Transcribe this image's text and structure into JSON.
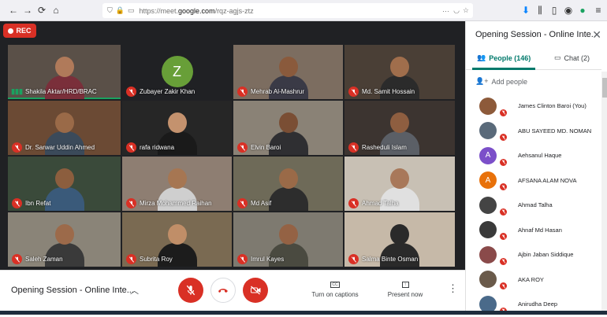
{
  "browser": {
    "url_prefix": "https://meet.",
    "url_host": "google.com",
    "url_path": "/rqz-agjs-ztz"
  },
  "rec_label": "REC",
  "tiles": [
    {
      "name": "Shakila Aktar/HRD/BRAC",
      "speaking": true,
      "bg": "#5a5048",
      "skin": "#b07a5a",
      "shirt": "#7a2f3a"
    },
    {
      "name": "Zubayer Zakir Khan",
      "avatar": "Z",
      "bg": "#202124"
    },
    {
      "name": "Mehrab Al-Mashrur",
      "bg": "#7c6d60",
      "skin": "#8a5a3c",
      "shirt": "#3a3a46"
    },
    {
      "name": "Md. Samit Hossain",
      "bg": "#4a3f36",
      "skin": "#a06e4c",
      "shirt": "#2b2b2b"
    },
    {
      "name": "Dr. Sarwar Uddin Ahmed",
      "bg": "#6b4a34",
      "skin": "#9a6a48",
      "shirt": "#3b4a5a"
    },
    {
      "name": "rafa ridwana",
      "bg": "#262626",
      "skin": "#c4926e",
      "shirt": "#1a1a1a"
    },
    {
      "name": "Elvin Baroi",
      "bg": "#8a8276",
      "skin": "#7a4e34",
      "shirt": "#2f2f32"
    },
    {
      "name": "Rasheduli Islam",
      "bg": "#3c3430",
      "skin": "#8e5e40",
      "shirt": "#5b5f66"
    },
    {
      "name": "Ibn Refat",
      "bg": "#3a4a3a",
      "skin": "#8c5e3e",
      "shirt": "#3a5a7a"
    },
    {
      "name": "Mirza Mohammed Raihan",
      "bg": "#8e7e72",
      "skin": "#a67652",
      "shirt": "#cfcfcf"
    },
    {
      "name": "Md Asif",
      "bg": "#6e6a58",
      "skin": "#9a6a48",
      "shirt": "#2d2d2d"
    },
    {
      "name": "Ahmad Talha",
      "bg": "#c8c0b4",
      "skin": "#a8785a",
      "shirt": "#e0e0e0"
    },
    {
      "name": "Saleh Zaman",
      "bg": "#8a8478",
      "skin": "#9c6a4a",
      "shirt": "#3a3a3a"
    },
    {
      "name": "Subrita Roy",
      "bg": "#7a6a52",
      "skin": "#c08e68",
      "shirt": "#1c1c1c"
    },
    {
      "name": "Imrul Kayes",
      "bg": "#7e7a70",
      "skin": "#946244",
      "shirt": "#4a4a40"
    },
    {
      "name": "Salma Binte Osman",
      "bg": "#c6b9a8",
      "skin": "#2a2a2a",
      "shirt": "#2a2a2a"
    }
  ],
  "bottom": {
    "meeting_title": "Opening Session - Online Inte...",
    "captions_label": "Turn on captions",
    "present_label": "Present now"
  },
  "side": {
    "title": "Opening Session - Online Inte...",
    "people_tab": "People (146)",
    "chat_tab": "Chat (2)",
    "add_people": "Add people",
    "participants": [
      {
        "name": "James Clinton Baroi (You)",
        "color": "#8d5a3a",
        "initial": ""
      },
      {
        "name": "ABU SAYEED MD. NOMAN",
        "color": "#5a6a7a",
        "initial": ""
      },
      {
        "name": "Aehsanul Haque",
        "color": "#7b4fc9",
        "initial": "A"
      },
      {
        "name": "AFSANA ALAM NOVA",
        "color": "#e8710a",
        "initial": "A"
      },
      {
        "name": "Ahmad Talha",
        "color": "#444",
        "initial": ""
      },
      {
        "name": "Ahnaf Md Hasan",
        "color": "#3a3a3a",
        "initial": ""
      },
      {
        "name": "Ajbin Jaban Siddique",
        "color": "#8a4a4a",
        "initial": ""
      },
      {
        "name": "AKA ROY",
        "color": "#6a5a4a",
        "initial": ""
      },
      {
        "name": "Anirudha Deep",
        "color": "#4a6a8a",
        "initial": ""
      }
    ]
  }
}
